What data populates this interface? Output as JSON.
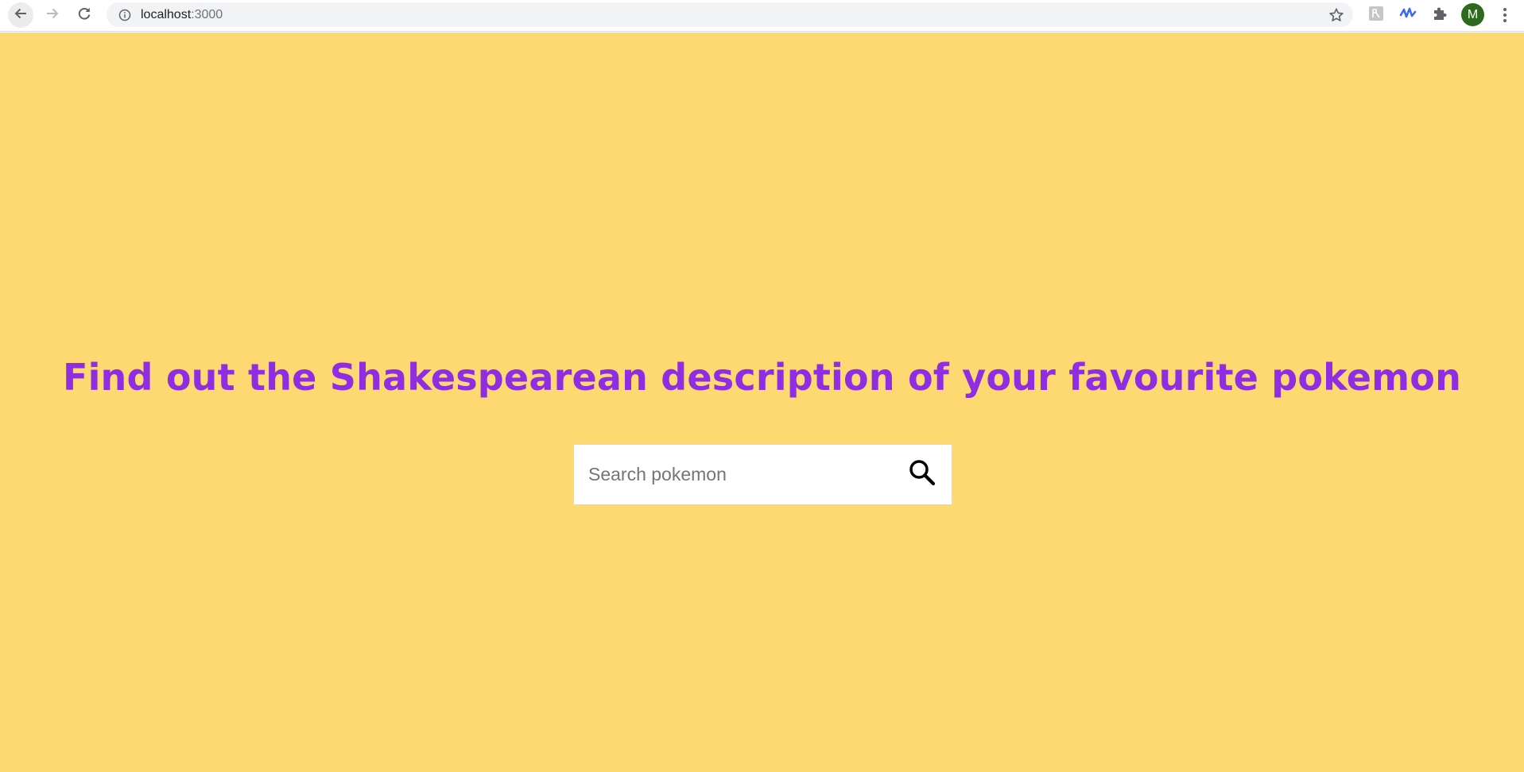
{
  "browser": {
    "url_host": "localhost",
    "url_port": ":3000",
    "profile_initial": "M",
    "icons": {
      "back": "arrow-left-icon",
      "forward": "arrow-right-icon",
      "reload": "reload-icon",
      "site_info": "info-icon",
      "bookmark": "star-icon",
      "extension_1": "extension-translate-icon",
      "extension_2": "extension-wave-icon",
      "extensions": "puzzle-icon",
      "menu": "kebab-menu-icon"
    }
  },
  "page": {
    "heading": "Find out the Shakespearean description of your favourite pokemon",
    "search": {
      "placeholder": "Search pokemon",
      "value": ""
    }
  },
  "colors": {
    "page_background": "#fed870",
    "heading": "#8e2de2",
    "search_box": "#ffffff",
    "avatar": "#2d6a1f",
    "extension_wave": "#3d6bf0"
  }
}
